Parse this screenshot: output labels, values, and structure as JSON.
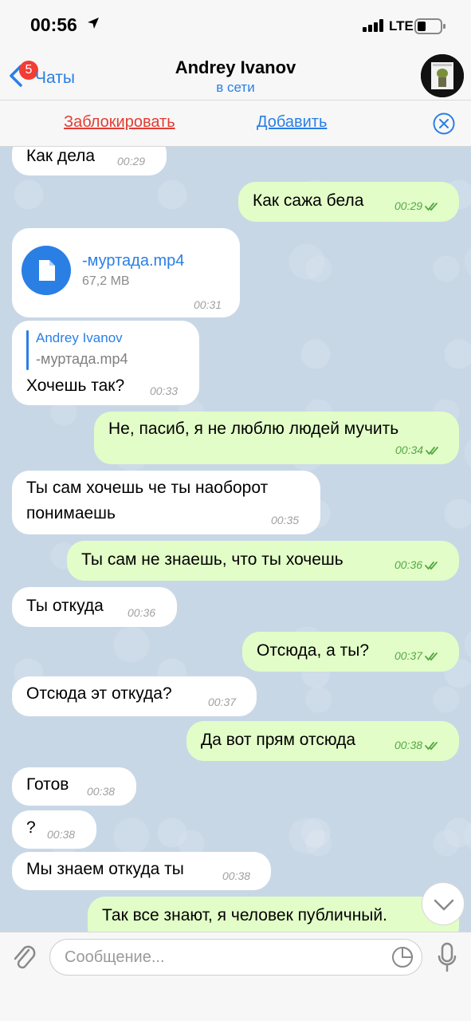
{
  "status_bar": {
    "time": "00:56",
    "network": "LTE"
  },
  "header": {
    "back_label": "Чаты",
    "unread_badge": "5",
    "contact_name": "Andrey Ivanov",
    "contact_status": "в сети",
    "avatar_icon": "avatar-image"
  },
  "action_bar": {
    "block_label": "Заблокировать",
    "add_label": "Добавить"
  },
  "messages": [
    {
      "direction": "in",
      "text": "Как дела",
      "time": "00:29"
    },
    {
      "direction": "out",
      "text": "Как сажа бела",
      "time": "00:29"
    },
    {
      "direction": "in",
      "type": "file",
      "file_name": "-муртада.mp4",
      "file_size": "67,2 MB",
      "time": "00:31"
    },
    {
      "direction": "in",
      "reply_author": "Andrey Ivanov",
      "reply_text": "-муртада.mp4",
      "text": "Хочешь так?",
      "time": "00:33"
    },
    {
      "direction": "out",
      "text": "Не, пасиб, я не люблю людей мучить",
      "time": "00:34"
    },
    {
      "direction": "in",
      "text_line1": "Ты сам хочешь че ты наоборот",
      "text_line2": "понимаешь",
      "time": "00:35"
    },
    {
      "direction": "out",
      "text": "Ты сам не знаешь, что ты хочешь",
      "time": "00:36"
    },
    {
      "direction": "in",
      "text": "Ты откуда",
      "time": "00:36"
    },
    {
      "direction": "out",
      "text": "Отсюда, а ты?",
      "time": "00:37"
    },
    {
      "direction": "in",
      "text": "Отсюда эт откуда?",
      "time": "00:37"
    },
    {
      "direction": "out",
      "text": "Да вот прям отсюда",
      "time": "00:38"
    },
    {
      "direction": "in",
      "text": "Готов",
      "time": "00:38"
    },
    {
      "direction": "in",
      "text": "?",
      "time": "00:38"
    },
    {
      "direction": "in",
      "text": "Мы знаем откуда ты",
      "time": "00:38"
    },
    {
      "direction": "out",
      "text": "Так все знают, я человек публичный.",
      "time": ""
    }
  ],
  "composer": {
    "placeholder": "Сообщение..."
  },
  "colors": {
    "accent": "#2a7fe5",
    "destructive": "#e23d33",
    "outgoing_bubble": "#e2fdc8",
    "incoming_bubble": "#ffffff",
    "badge": "#f23c34"
  }
}
